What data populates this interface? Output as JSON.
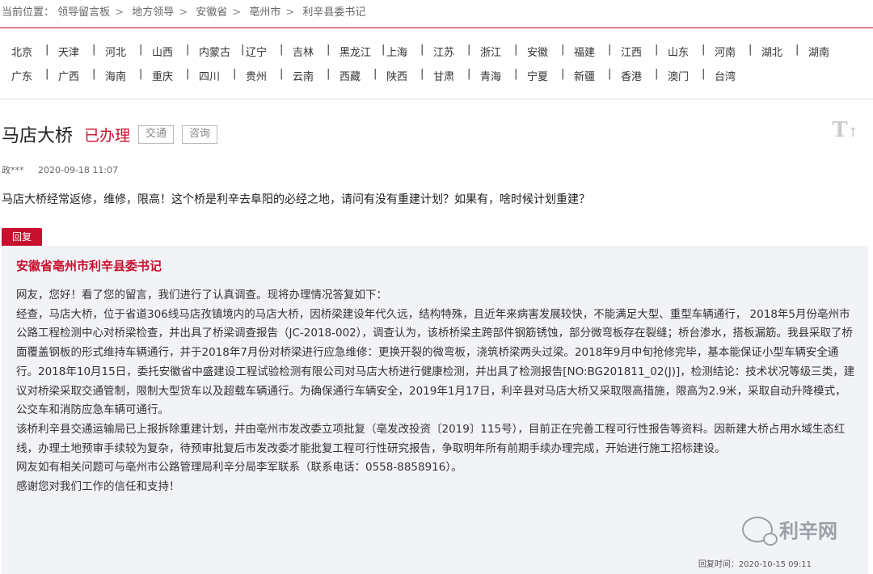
{
  "breadcrumb": {
    "label": "当前位置：",
    "items": [
      "领导留言板",
      "地方领导",
      "安徽省",
      "亳州市",
      "利辛县委书记"
    ],
    "separator": ">"
  },
  "regions": {
    "row1": [
      "北京",
      "天津",
      "河北",
      "山西",
      "内蒙古",
      "辽宁",
      "吉林",
      "黑龙江",
      "上海",
      "江苏",
      "浙江",
      "安徽",
      "福建",
      "江西",
      "山东",
      "河南",
      "湖北",
      "湖南"
    ],
    "row2": [
      "广东",
      "广西",
      "海南",
      "重庆",
      "四川",
      "贵州",
      "云南",
      "西藏",
      "陕西",
      "甘肃",
      "青海",
      "宁夏",
      "新疆",
      "香港",
      "澳门",
      "台湾"
    ],
    "divider": "|"
  },
  "post": {
    "title": "马店大桥",
    "status": "已办理",
    "tags": [
      "交通",
      "咨询"
    ],
    "author": "政***",
    "time": "2020-09-18 11:07",
    "content": "马店大桥经常返修，维修，限高！这个桥是利辛去阜阳的必经之地，请问有没有重建计划？如果有，啥时候计划重建？"
  },
  "font_toggle": {
    "big": "T",
    "small": "↑"
  },
  "reply": {
    "badge": "回复",
    "org": "安徽省亳州市利辛县委书记",
    "paragraphs": [
      "网友，您好！看了您的留言，我们进行了认真调查。现将办理情况答复如下：",
      "经查，马店大桥，位于省道306线马店孜镇境内的马店大桥，因桥梁建设年代久远，结构特殊，且近年来病害发展较快，不能满足大型、重型车辆通行， 2018年5月份亳州市公路工程检测中心对桥梁检查，并出具了桥梁调查报告（JC-2018-002），调查认为，该桥桥梁主跨部件钢筋锈蚀，部分微弯板存在裂缝；桥台渗水，搭板漏筋。我县采取了桥面覆盖钢板的形式维持车辆通行，并于2018年7月份对桥梁进行应急维修：更换开裂的微弯板，浇筑桥梁两头过梁。2018年9月中旬抢修完毕，基本能保证小型车辆安全通行。2018年10月15日，委托安徽省中盛建设工程试验检测有限公司对马店大桥进行健康检测，并出具了检测报告[NO:BG201811_02(J)]，检测结论：技术状况等级三类，建议对桥梁采取交通管制，限制大型货车以及超载车辆通行。为确保通行车辆安全，2019年1月17日，利辛县对马店大桥又采取限高措施，限高为2.9米，采取自动升降模式，公交车和消防应急车辆可通行。",
      "该桥利辛县交通运输局已上报拆除重建计划，并由亳州市发改委立项批复（亳发改投资〔2019〕115号），目前正在完善工程可行性报告等资料。因新建大桥占用水域生态红线，办理土地预审手续较为复杂，待预审批复后市发改委才能批复工程可行性研究报告，争取明年所有前期手续办理完成，开始进行施工招标建设。",
      "网友如有相关问题可与亳州市公路管理局利辛分局李军联系（联系电话：0558-8858916）。",
      "感谢您对我们工作的信任和支持！"
    ],
    "time": "回复时间：2020-10-15 09:11",
    "watermark": "利辛网"
  }
}
